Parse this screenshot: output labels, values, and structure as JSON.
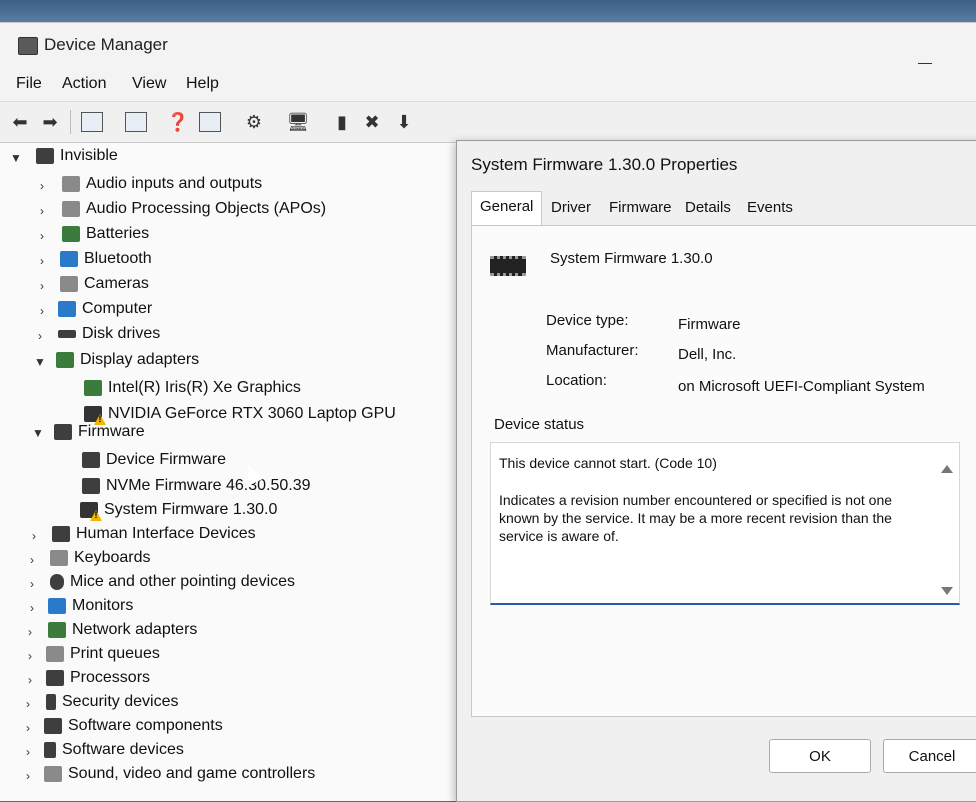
{
  "window": {
    "title": "Device Manager"
  },
  "menu": [
    "File",
    "Action",
    "View",
    "Help"
  ],
  "toolbar": [
    "back-icon",
    "forward-icon",
    "properties-icon",
    "view-icon",
    "help-icon",
    "properties2-icon",
    "scan-icon",
    "monitor-icon",
    "enable-icon",
    "uninstall-icon",
    "download-icon"
  ],
  "tree": {
    "root": "Invisible",
    "items": [
      {
        "label": "Audio inputs and outputs",
        "icon": "speaker-icon"
      },
      {
        "label": "Audio Processing Objects (APOs)",
        "icon": "speaker-icon"
      },
      {
        "label": "Batteries",
        "icon": "battery-icon"
      },
      {
        "label": "Bluetooth",
        "icon": "bluetooth-icon"
      },
      {
        "label": "Cameras",
        "icon": "camera-icon"
      },
      {
        "label": "Computer",
        "icon": "computer-icon"
      },
      {
        "label": "Disk drives",
        "icon": "disk-icon"
      },
      {
        "label": "Display adapters",
        "icon": "display-adapter-icon"
      },
      {
        "label": "Intel(R) Iris(R) Xe Graphics",
        "icon": "display-adapter-icon"
      },
      {
        "label": "NVIDIA GeForce RTX 3060 Laptop GPU",
        "icon": "warning-icon"
      },
      {
        "label": "Firmware",
        "icon": "firmware-icon"
      },
      {
        "label": "Device Firmware",
        "icon": "firmware-icon"
      },
      {
        "label": "NVMe Firmware 46.30.50.39",
        "icon": "firmware-icon"
      },
      {
        "label": "System Firmware 1.30.0",
        "icon": "warning-icon"
      },
      {
        "label": "Human Interface Devices",
        "icon": "hid-icon"
      },
      {
        "label": "Keyboards",
        "icon": "keyboard-icon"
      },
      {
        "label": "Mice and other pointing devices",
        "icon": "mouse-icon"
      },
      {
        "label": "Monitors",
        "icon": "monitor-icon"
      },
      {
        "label": "Network adapters",
        "icon": "network-icon"
      },
      {
        "label": "Print queues",
        "icon": "printer-icon"
      },
      {
        "label": "Processors",
        "icon": "processor-icon"
      },
      {
        "label": "Security devices",
        "icon": "security-icon"
      },
      {
        "label": "Software components",
        "icon": "software-icon"
      },
      {
        "label": "Software devices",
        "icon": "software-icon"
      },
      {
        "label": "Sound, video and game controllers",
        "icon": "sound-icon"
      }
    ]
  },
  "dialog": {
    "title": "System Firmware 1.30.0 Properties",
    "tabs": [
      "General",
      "Driver",
      "Firmware",
      "Details",
      "Events"
    ],
    "device_name": "System Firmware 1.30.0",
    "fields": [
      {
        "label": "Device type:",
        "value": "Firmware"
      },
      {
        "label": "Manufacturer:",
        "value": "Dell, Inc."
      },
      {
        "label": "Location:",
        "value": "on Microsoft UEFI-Compliant System"
      }
    ],
    "status_title": "Device status",
    "status_line1": "This device cannot start. (Code 10)",
    "status_line2": "Indicates a revision number encountered or specified is not one known by the service. It may be a more recent revision than the service is aware of.",
    "ok": "OK",
    "cancel": "Cancel"
  }
}
